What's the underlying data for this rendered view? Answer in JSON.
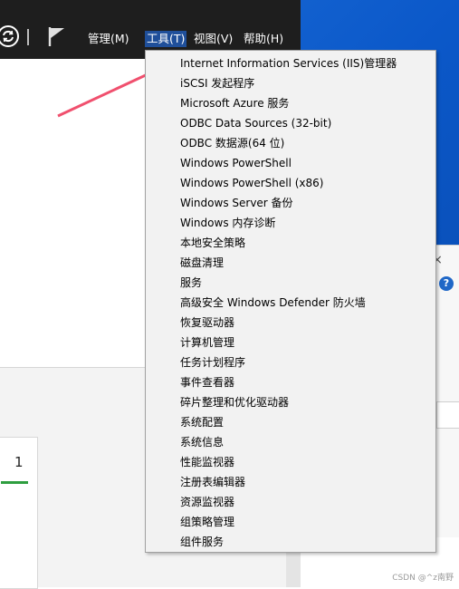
{
  "header": {
    "menus": [
      {
        "label": "管理(M)"
      },
      {
        "label": "工具(T)"
      },
      {
        "label": "视图(V)"
      },
      {
        "label": "帮助(H)"
      }
    ],
    "active_menu": "工具(T)"
  },
  "dropdown": {
    "items": [
      "Internet Information Services (IIS)管理器",
      "iSCSI 发起程序",
      "Microsoft Azure 服务",
      "ODBC Data Sources (32-bit)",
      "ODBC 数据源(64 位)",
      "Windows PowerShell",
      "Windows PowerShell (x86)",
      "Windows Server 备份",
      "Windows 内存诊断",
      "本地安全策略",
      "磁盘清理",
      "服务",
      "高级安全 Windows Defender 防火墙",
      "恢复驱动器",
      "计算机管理",
      "任务计划程序",
      "事件查看器",
      "碎片整理和优化驱动器",
      "系统配置",
      "系统信息",
      "性能监视器",
      "注册表编辑器",
      "资源监视器",
      "组策略管理",
      "组件服务"
    ]
  },
  "tile": {
    "number": "1"
  },
  "right_window": {
    "close": "×",
    "help": "?"
  },
  "watermark": "CSDN @^z南野",
  "colors": {
    "header_bg": "#1e1e1e",
    "active_menu_bg": "#1f4f9a",
    "annotation_arrow": "#f0506e",
    "desktop_blue": "#0b58c9",
    "tile_bar": "#2e9e3f"
  },
  "icons": [
    "refresh-icon",
    "flag-icon",
    "help-icon"
  ]
}
